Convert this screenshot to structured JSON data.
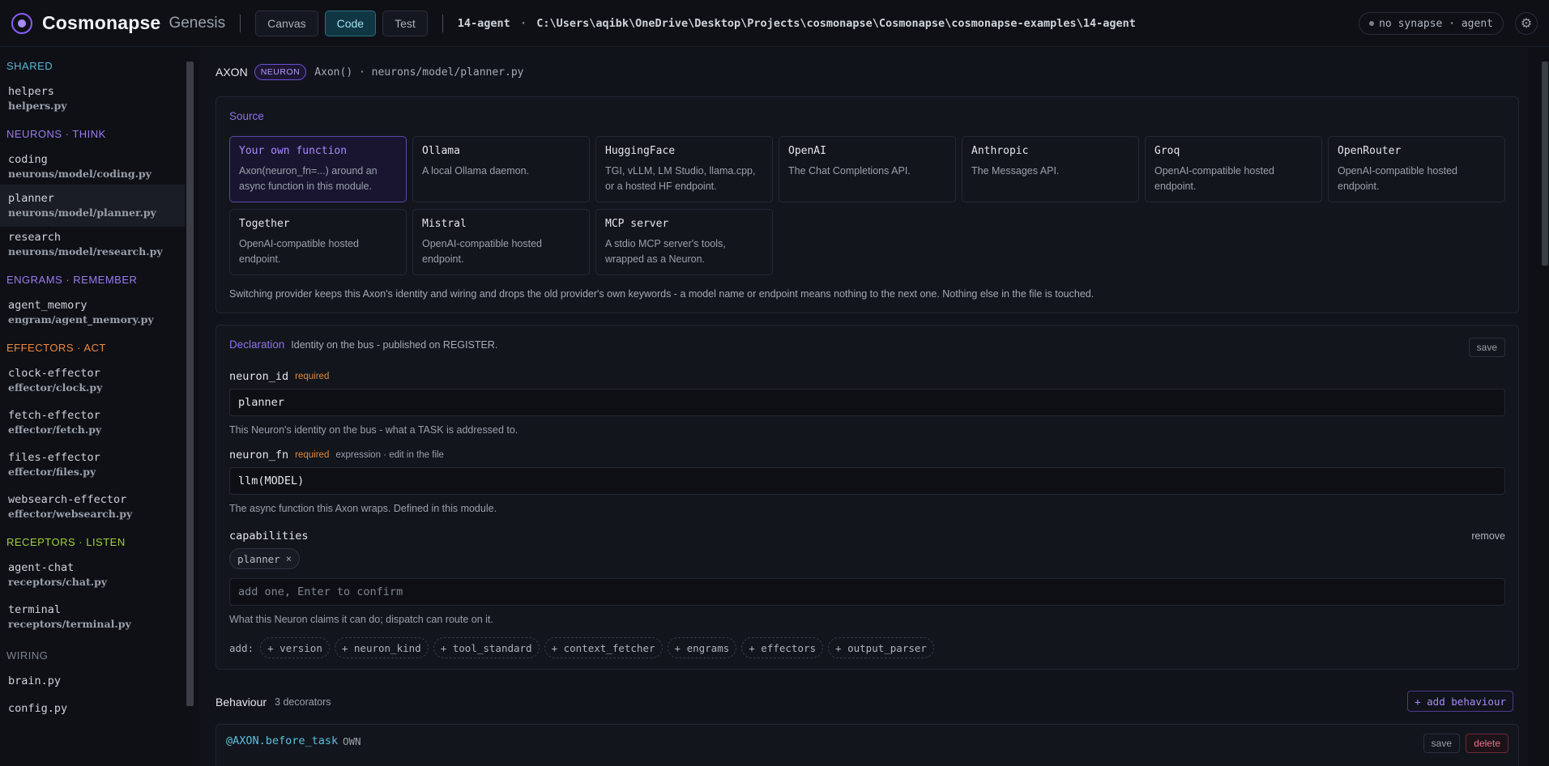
{
  "app": {
    "brand": "Cosmonapse",
    "subtitle": "Genesis"
  },
  "topbar": {
    "tabs": [
      "Canvas",
      "Code",
      "Test"
    ],
    "path_name": "14-agent",
    "path_sep": "·",
    "path_full": "C:\\Users\\aqibk\\OneDrive\\Desktop\\Projects\\cosmonapse\\Cosmonapse\\cosmonapse-examples\\14-agent",
    "status": "no synapse · agent"
  },
  "sidebar": {
    "shared_title": "SHARED",
    "shared": [
      {
        "name": "helpers",
        "file": "helpers.py"
      }
    ],
    "neurons_title": "NEURONS · THINK",
    "neurons": [
      {
        "name": "coding",
        "file": "neurons/model/coding.py"
      },
      {
        "name": "planner",
        "file": "neurons/model/planner.py"
      },
      {
        "name": "research",
        "file": "neurons/model/research.py"
      }
    ],
    "engrams_title": "ENGRAMS · REMEMBER",
    "engrams": [
      {
        "name": "agent_memory",
        "file": "engram/agent_memory.py"
      }
    ],
    "effectors_title": "EFFECTORS · ACT",
    "effectors": [
      {
        "name": "clock-effector",
        "file": "effector/clock.py"
      },
      {
        "name": "fetch-effector",
        "file": "effector/fetch.py"
      },
      {
        "name": "files-effector",
        "file": "effector/files.py"
      },
      {
        "name": "websearch-effector",
        "file": "effector/websearch.py"
      }
    ],
    "receptors_title": "RECEPTORS · LISTEN",
    "receptors": [
      {
        "name": "agent-chat",
        "file": "receptors/chat.py"
      },
      {
        "name": "terminal",
        "file": "receptors/terminal.py"
      }
    ],
    "wiring_title": "WIRING",
    "wiring": [
      "brain.py",
      "config.py"
    ]
  },
  "header": {
    "kind": "AXON",
    "badge": "NEURON",
    "path": "Axon() · neurons/model/planner.py"
  },
  "source": {
    "title": "Source",
    "providers": [
      {
        "name": "Your own function",
        "desc": "Axon(neuron_fn=...) around an async function in this module."
      },
      {
        "name": "Ollama",
        "desc": "A local Ollama daemon."
      },
      {
        "name": "HuggingFace",
        "desc": "TGI, vLLM, LM Studio, llama.cpp, or a hosted HF endpoint."
      },
      {
        "name": "OpenAI",
        "desc": "The Chat Completions API."
      },
      {
        "name": "Anthropic",
        "desc": "The Messages API."
      },
      {
        "name": "Groq",
        "desc": "OpenAI-compatible hosted endpoint."
      },
      {
        "name": "OpenRouter",
        "desc": "OpenAI-compatible hosted endpoint."
      },
      {
        "name": "Together",
        "desc": "OpenAI-compatible hosted endpoint."
      },
      {
        "name": "Mistral",
        "desc": "OpenAI-compatible hosted endpoint."
      },
      {
        "name": "MCP server",
        "desc": "A stdio MCP server's tools, wrapped as a Neuron."
      }
    ],
    "note": "Switching provider keeps this Axon's identity and wiring and drops the old provider's own keywords - a model name or endpoint means nothing to the next one. Nothing else in the file is touched."
  },
  "declaration": {
    "title": "Declaration",
    "subtitle": "Identity on the bus - published on REGISTER.",
    "save": "save",
    "neuron_id_label": "neuron_id",
    "required": "required",
    "neuron_id_value": "planner",
    "neuron_id_help": "This Neuron's identity on the bus - what a TASK is addressed to.",
    "neuron_fn_label": "neuron_fn",
    "neuron_fn_expr": "expression · edit in the file",
    "neuron_fn_value": "llm(MODEL)",
    "neuron_fn_help": "The async function this Axon wraps. Defined in this module.",
    "capabilities_label": "capabilities",
    "remove": "remove",
    "capability_chip": "planner",
    "chip_close": "×",
    "cap_placeholder": "add one, Enter to confirm",
    "cap_help": "What this Neuron claims it can do; dispatch can route on it.",
    "add_label": "add:",
    "add_options": [
      "+ version",
      "+ neuron_kind",
      "+ tool_standard",
      "+ context_fetcher",
      "+ engrams",
      "+ effectors",
      "+ output_parser"
    ]
  },
  "behaviour": {
    "title": "Behaviour",
    "count": "3 decorators",
    "add": "+ add behaviour",
    "decorator": "@AXON.before_task",
    "decorator_tag": "OWN",
    "save": "save",
    "delete": "delete"
  }
}
